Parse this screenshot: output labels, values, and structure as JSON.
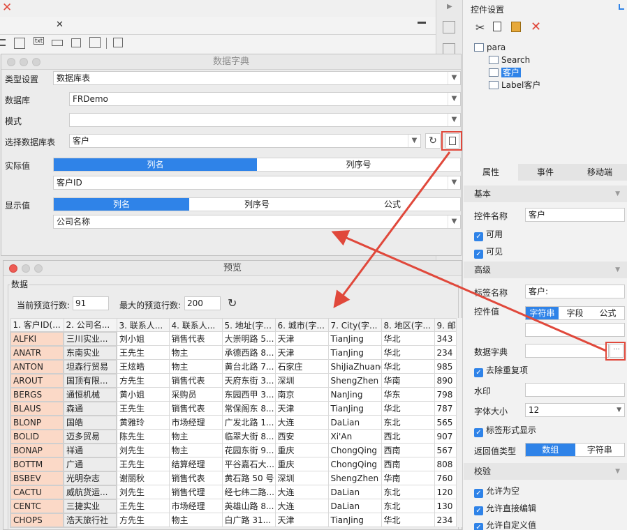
{
  "editor": {
    "close_glyph": "✕",
    "txt_badge": "txt",
    "tool_icons": [
      "list-icon",
      "checklist-icon",
      "text-field-icon",
      "number-field-icon",
      "checkbox-icon",
      "tree-icon",
      "combo-icon"
    ]
  },
  "right_panel": {
    "title": "控件设置",
    "tree": [
      "para",
      "Search",
      "客户",
      "Label客户"
    ],
    "tabs": [
      "属性",
      "事件",
      "移动端"
    ],
    "basic": {
      "header": "基本",
      "name_label": "控件名称",
      "name_value": "客户",
      "enabled": "可用",
      "visible": "可见"
    },
    "advanced": {
      "header": "高级",
      "label_name_label": "标签名称",
      "label_name_value": "客户:",
      "value_label": "控件值",
      "value_types": [
        "字符串",
        "字段",
        "公式"
      ],
      "dict_label": "数据字典",
      "dict_btn": "···",
      "dedupe": "去除重复项",
      "watermark_label": "水印",
      "font_size_label": "字体大小",
      "font_size_value": "12",
      "label_style": "标签形式显示",
      "return_type_label": "返回值类型",
      "return_types": [
        "数组",
        "字符串"
      ]
    },
    "validate": {
      "header": "校验",
      "allow_empty": "允许为空",
      "allow_edit": "允许直接编辑",
      "allow_custom": "允许自定义值"
    }
  },
  "dict_dialog": {
    "title": "数据字典",
    "type_label": "类型设置",
    "type_value": "数据库表",
    "db_label": "数据库",
    "db_value": "FRDemo",
    "schema_label": "模式",
    "schema_value": "",
    "table_label": "选择数据库表",
    "table_value": "客户",
    "actual_label": "实际值",
    "actual_tabs": [
      "列名",
      "列序号"
    ],
    "actual_value": "客户ID",
    "display_label": "显示值",
    "display_tabs": [
      "列名",
      "列序号",
      "公式"
    ],
    "display_value": "公司名称"
  },
  "preview_dialog": {
    "title": "预览",
    "group_label": "数据",
    "cur_rows_label": "当前预览行数:",
    "cur_rows_value": "91",
    "max_rows_label": "最大的预览行数:",
    "max_rows_value": "200",
    "columns": [
      "1. 客户ID(...",
      "2. 公司名...",
      "3. 联系人...",
      "4. 联系人...",
      "5. 地址(字...",
      "6. 城市(字...",
      "7. City(字...",
      "8. 地区(字...",
      "9. 邮"
    ],
    "rows": [
      [
        "ALFKI",
        "三川实业...",
        "刘小姐",
        "销售代表",
        "大崇明路 5...",
        "天津",
        "TianJing",
        "华北",
        "343"
      ],
      [
        "ANATR",
        "东南实业",
        "王先生",
        "物主",
        "承德西路 8...",
        "天津",
        "TianJing",
        "华北",
        "234"
      ],
      [
        "ANTON",
        "坦森行贸易",
        "王炫皓",
        "物主",
        "黄台北路 7...",
        "石家庄",
        "ShiJiaZhuang",
        "华北",
        "985"
      ],
      [
        "AROUT",
        "国顶有限...",
        "方先生",
        "销售代表",
        "天府东街 3...",
        "深圳",
        "ShengZhen",
        "华南",
        "890"
      ],
      [
        "BERGS",
        "通恒机械",
        "黄小姐",
        "采购员",
        "东园西甲 3...",
        "南京",
        "NanJing",
        "华东",
        "798"
      ],
      [
        "BLAUS",
        "森通",
        "王先生",
        "销售代表",
        "常保阁东 8...",
        "天津",
        "TianJing",
        "华北",
        "787"
      ],
      [
        "BLONP",
        "国皓",
        "黄雅玲",
        "市场经理",
        "广发北路 1...",
        "大连",
        "DaLian",
        "东北",
        "565"
      ],
      [
        "BOLID",
        "迈多贸易",
        "陈先生",
        "物主",
        "临翠大街 8...",
        "西安",
        "Xi'An",
        "西北",
        "907"
      ],
      [
        "BONAP",
        "祥通",
        "刘先生",
        "物主",
        "花园东街 9...",
        "重庆",
        "ChongQing",
        "西南",
        "567"
      ],
      [
        "BOTTM",
        "广通",
        "王先生",
        "结算经理",
        "平谷嘉石大...",
        "重庆",
        "ChongQing",
        "西南",
        "808"
      ],
      [
        "BSBEV",
        "光明杂志",
        "谢丽秋",
        "销售代表",
        "黄石路 50 号",
        "深圳",
        "ShengZhen",
        "华南",
        "760"
      ],
      [
        "CACTU",
        "威航货运...",
        "刘先生",
        "销售代理",
        "经七纬二路...",
        "大连",
        "DaLian",
        "东北",
        "120"
      ],
      [
        "CENTC",
        "三捷实业",
        "王先生",
        "市场经理",
        "英雄山路 8...",
        "大连",
        "DaLian",
        "东北",
        "130"
      ],
      [
        "CHOPS",
        "浩天旅行社",
        "方先生",
        "物主",
        "白广路 31...",
        "天津",
        "TianJing",
        "华北",
        "234"
      ]
    ]
  },
  "colors": {
    "accent": "#2f83e8",
    "annotation_red": "#e0483b",
    "key_cell": "#fbd9c7"
  }
}
